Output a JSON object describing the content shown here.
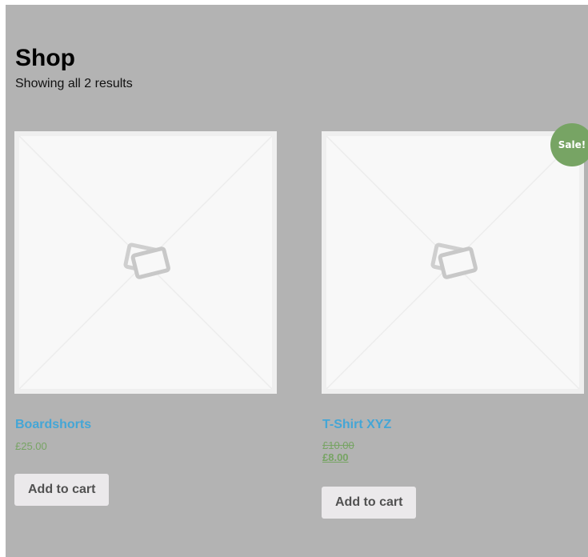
{
  "page": {
    "title": "Shop",
    "result_count": "Showing all 2 results"
  },
  "products": [
    {
      "name": "Boardshorts",
      "price": "£25.00",
      "add_to_cart": "Add to cart",
      "image_icon": "placeholder-image-icon"
    },
    {
      "name": "T-Shirt XYZ",
      "sale_badge": "Sale!",
      "old_price": "£10.00",
      "new_price": "£8.00",
      "add_to_cart": "Add to cart",
      "image_icon": "placeholder-image-icon"
    }
  ],
  "colors": {
    "background": "#b3b3b3",
    "link": "#44a6d6",
    "price": "#77a464",
    "sale_badge": "#77a464",
    "button": "#ebe9eb"
  }
}
